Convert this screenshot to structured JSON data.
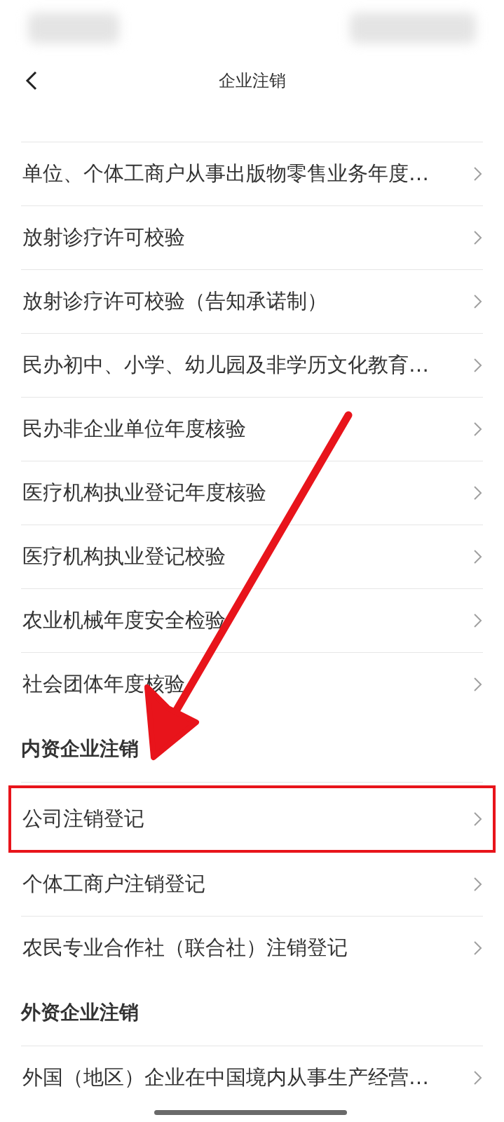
{
  "header": {
    "title": "企业注销"
  },
  "sections": [
    {
      "items": [
        {
          "label": "单位、个体工商户从事出版物零售业务年度…",
          "highlighted": false
        },
        {
          "label": "放射诊疗许可校验",
          "highlighted": false
        },
        {
          "label": "放射诊疗许可校验（告知承诺制）",
          "highlighted": false
        },
        {
          "label": "民办初中、小学、幼儿园及非学历文化教育…",
          "highlighted": false
        },
        {
          "label": "民办非企业单位年度核验",
          "highlighted": false
        },
        {
          "label": "医疗机构执业登记年度核验",
          "highlighted": false
        },
        {
          "label": "医疗机构执业登记校验",
          "highlighted": false
        },
        {
          "label": "农业机械年度安全检验",
          "highlighted": false
        },
        {
          "label": "社会团体年度核验",
          "highlighted": false
        }
      ]
    },
    {
      "title": "内资企业注销",
      "items": [
        {
          "label": "公司注销登记",
          "highlighted": true
        },
        {
          "label": "个体工商户注销登记",
          "highlighted": false
        },
        {
          "label": "农民专业合作社（联合社）注销登记",
          "highlighted": false
        }
      ]
    },
    {
      "title": "外资企业注销",
      "items": [
        {
          "label": "外国（地区）企业在中国境内从事生产经营…",
          "highlighted": false
        }
      ]
    }
  ]
}
